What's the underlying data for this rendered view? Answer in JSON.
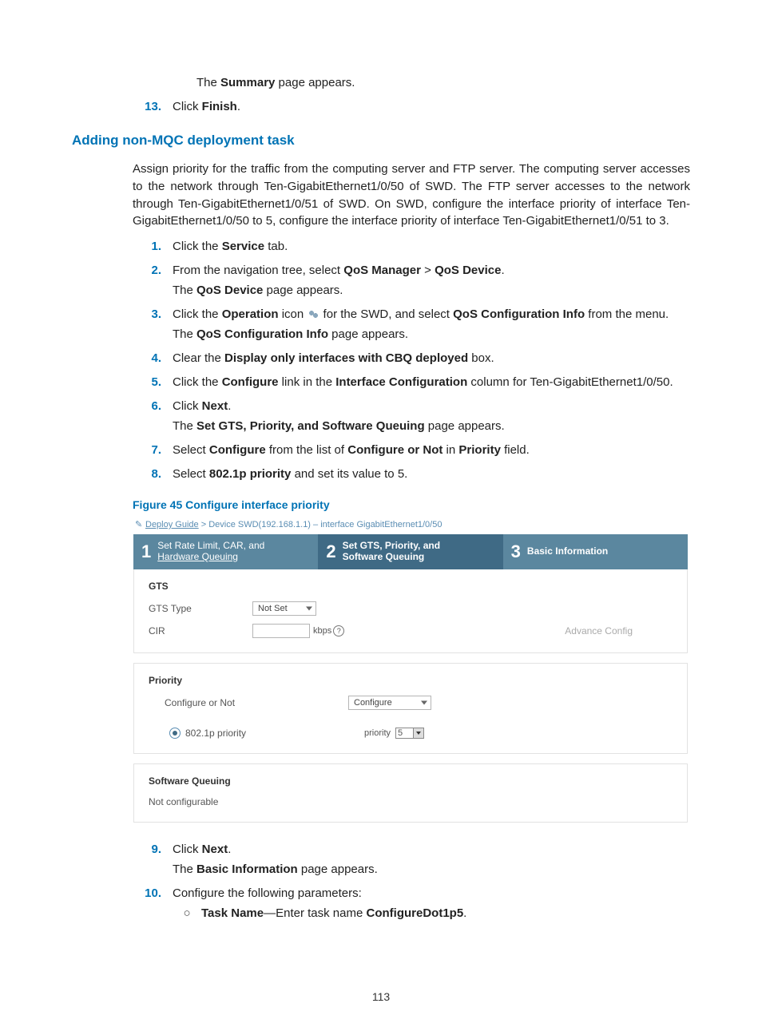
{
  "pre_text": {
    "summary_line_prefix": "The ",
    "summary_bold": "Summary",
    "summary_line_suffix": " page appears."
  },
  "step13": {
    "num": "13.",
    "prefix": "Click ",
    "bold": "Finish",
    "suffix": "."
  },
  "heading": "Adding non-MQC deployment task",
  "intro_para": "Assign priority for the traffic from the computing server and FTP server. The computing server accesses to the network through Ten-GigabitEthernet1/0/50 of SWD. The FTP server accesses to the network through Ten-GigabitEthernet1/0/51 of SWD. On SWD, configure the interface priority of interface Ten-GigabitEthernet1/0/50 to 5, configure the interface priority of interface Ten-GigabitEthernet1/0/51 to 3.",
  "steps": {
    "s1": {
      "num": "1.",
      "pre": "Click the ",
      "b": "Service",
      "post": " tab."
    },
    "s2": {
      "num": "2.",
      "pre": "From the navigation tree, select ",
      "b1": "QoS Manager",
      "sep": " > ",
      "b2": "QoS Device",
      "post": ".",
      "line2_pre": "The ",
      "line2_b": "QoS Device",
      "line2_post": " page appears."
    },
    "s3": {
      "num": "3.",
      "pre": "Click the ",
      "b1": "Operation",
      "mid1": " icon ",
      "mid2": " for the SWD, and select ",
      "b2": "QoS Configuration Info",
      "post": " from the menu.",
      "line2_pre": "The ",
      "line2_b": "QoS Configuration Info",
      "line2_post": " page appears."
    },
    "s4": {
      "num": "4.",
      "pre": "Clear the ",
      "b": "Display only interfaces with CBQ deployed",
      "post": " box."
    },
    "s5": {
      "num": "5.",
      "pre": "Click the ",
      "b1": "Configure",
      "mid": " link in the ",
      "b2": "Interface Configuration",
      "post": " column for Ten-GigabitEthernet1/0/50."
    },
    "s6": {
      "num": "6.",
      "pre": "Click ",
      "b": "Next",
      "post": ".",
      "line2_pre": "The ",
      "line2_b": "Set GTS, Priority, and Software Queuing",
      "line2_post": " page appears."
    },
    "s7": {
      "num": "7.",
      "pre": "Select ",
      "b1": "Configure",
      "mid1": " from the list of ",
      "b2": "Configure or Not",
      "mid2": " in ",
      "b3": "Priority",
      "post": " field."
    },
    "s8": {
      "num": "8.",
      "pre": "Select ",
      "b": "802.1p priority",
      "post": " and set its value to 5."
    }
  },
  "fig_caption": "Figure 45 Configure interface priority",
  "figure": {
    "breadcrumb_label": "Deploy Guide",
    "breadcrumb_rest": " > Device SWD(192.168.1.1) – interface GigabitEthernet1/0/50",
    "tab1_line1": "Set Rate Limit, CAR, and",
    "tab1_line2": "Hardware Queuing",
    "tab2_line1": "Set GTS, Priority, and",
    "tab2_line2": "Software Queuing",
    "tab3": "Basic Information",
    "gts_title": "GTS",
    "gts_type_label": "GTS Type",
    "gts_type_value": "Not Set",
    "cir_label": "CIR",
    "cir_unit": "kbps",
    "advance": "Advance Config",
    "priority_title": "Priority",
    "conf_or_not_label": "Configure or Not",
    "conf_or_not_value": "Configure",
    "dot1p_label": "802.1p priority",
    "priority_word": "priority",
    "priority_value": "5",
    "sw_queue_title": "Software Queuing",
    "sw_queue_note": "Not configurable"
  },
  "steps2": {
    "s9": {
      "num": "9.",
      "pre": "Click ",
      "b": "Next",
      "post": ".",
      "line2_pre": "The ",
      "line2_b": "Basic Information",
      "line2_post": " page appears."
    },
    "s10": {
      "num": "10.",
      "text": "Configure the following parameters:"
    },
    "s10a": {
      "b": "Task Name",
      "mid": "—Enter task name ",
      "b2": "ConfigureDot1p5",
      "post": "."
    }
  },
  "page_number": "113"
}
